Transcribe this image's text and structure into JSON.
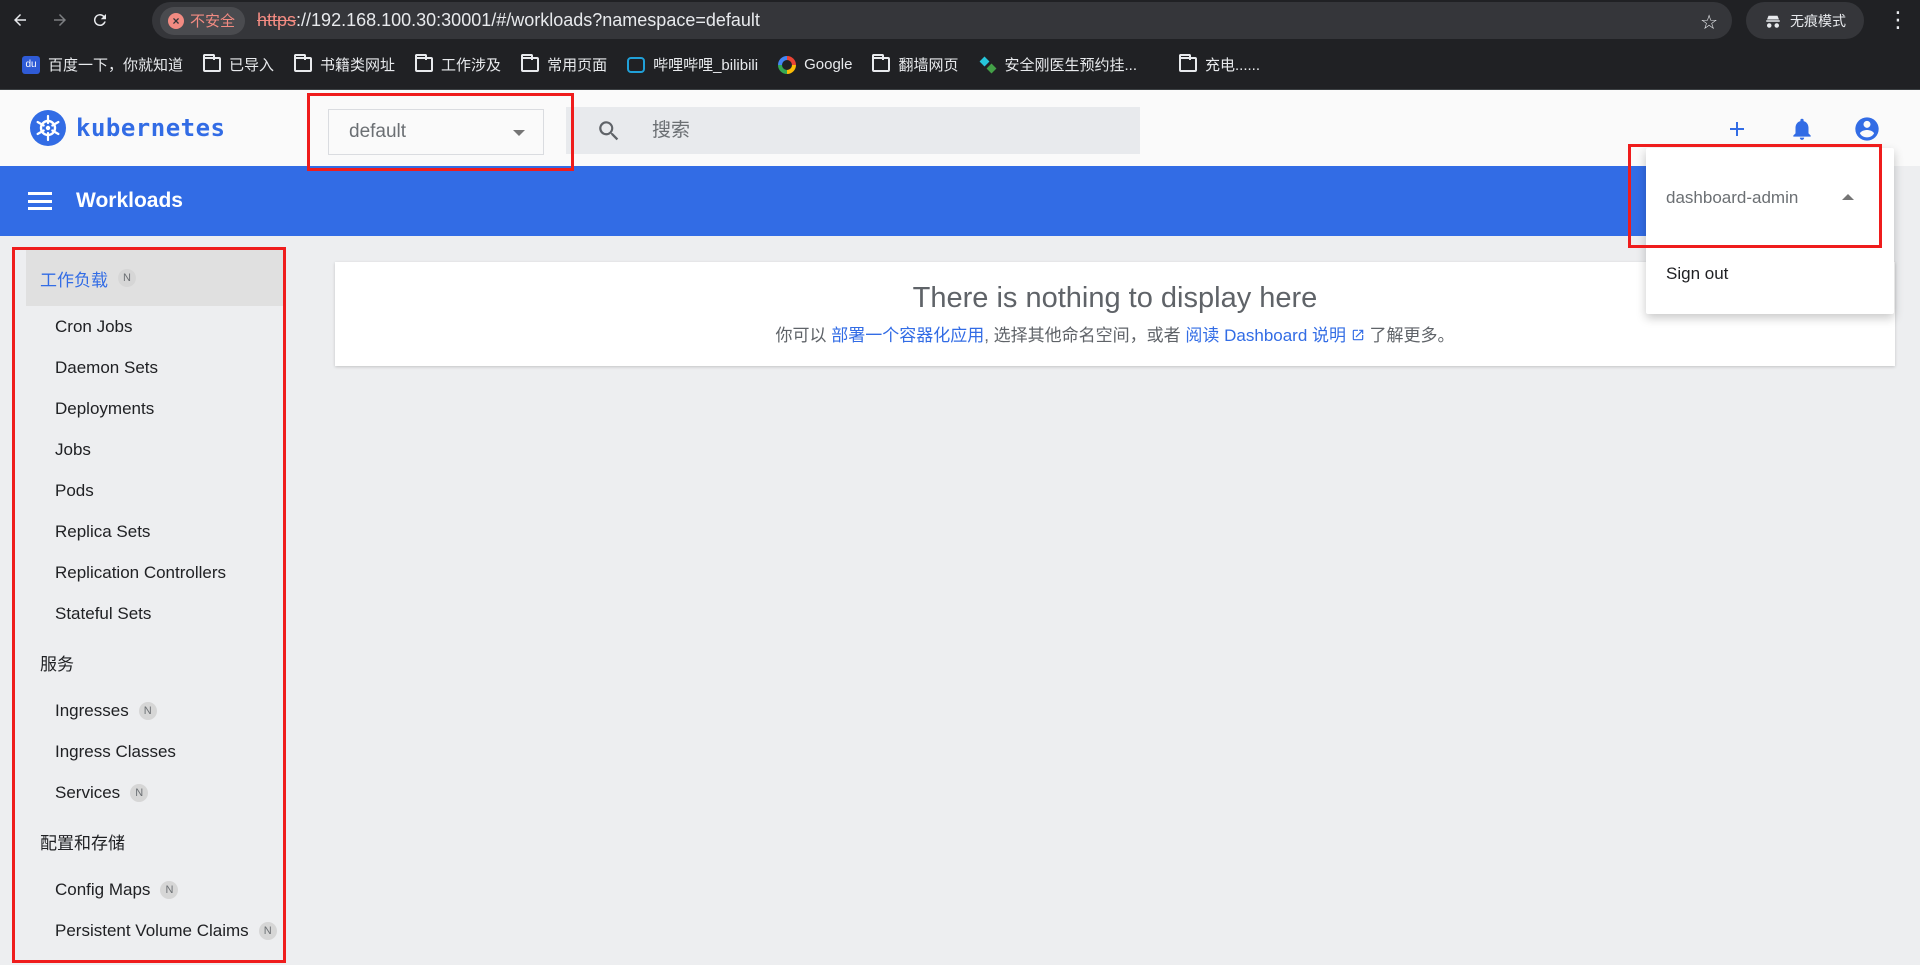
{
  "browser": {
    "insecure_label": "不安全",
    "url_scheme": "https",
    "url_rest": "://192.168.100.30:30001/#/workloads?namespace=default",
    "incognito_label": "无痕模式",
    "bookmarks": [
      {
        "label": "百度一下，你就知道",
        "icon": "baidu-icon"
      },
      {
        "label": "已导入",
        "icon": "folder-icon"
      },
      {
        "label": "书籍类网址",
        "icon": "folder-icon"
      },
      {
        "label": "工作涉及",
        "icon": "folder-icon"
      },
      {
        "label": "常用页面",
        "icon": "folder-icon"
      },
      {
        "label": "哔哩哔哩_bilibili",
        "icon": "bilibili-icon"
      },
      {
        "label": "Google",
        "icon": "google-icon"
      },
      {
        "label": "翻墙网页",
        "icon": "folder-icon"
      },
      {
        "label": "安全刚医生预约挂...",
        "icon": "site-icon"
      },
      {
        "label": "充电......",
        "icon": "folder-icon"
      }
    ]
  },
  "header": {
    "brand": "kubernetes",
    "namespace": "default",
    "search_placeholder": "搜索"
  },
  "title_bar": {
    "title": "Workloads"
  },
  "sidebar": {
    "sections": [
      {
        "label": "工作负载",
        "badge": "N",
        "items": [
          {
            "label": "Cron Jobs",
            "badge": ""
          },
          {
            "label": "Daemon Sets",
            "badge": ""
          },
          {
            "label": "Deployments",
            "badge": ""
          },
          {
            "label": "Jobs",
            "badge": ""
          },
          {
            "label": "Pods",
            "badge": ""
          },
          {
            "label": "Replica Sets",
            "badge": ""
          },
          {
            "label": "Replication Controllers",
            "badge": ""
          },
          {
            "label": "Stateful Sets",
            "badge": ""
          }
        ]
      },
      {
        "label": "服务",
        "badge": "",
        "items": [
          {
            "label": "Ingresses",
            "badge": "N"
          },
          {
            "label": "Ingress Classes",
            "badge": ""
          },
          {
            "label": "Services",
            "badge": "N"
          }
        ]
      },
      {
        "label": "配置和存储",
        "badge": "",
        "items": [
          {
            "label": "Config Maps",
            "badge": "N"
          },
          {
            "label": "Persistent Volume Claims",
            "badge": "N"
          }
        ]
      }
    ]
  },
  "empty_state": {
    "title": "There is nothing to display here",
    "desc_prefix": "你可以 ",
    "desc_link1": "部署一个容器化应用",
    "desc_mid": ", 选择其他命名空间，或者 ",
    "desc_link2": "阅读 Dashboard 说明",
    "desc_suffix": " 了解更多。"
  },
  "user_menu": {
    "username": "dashboard-admin",
    "sign_out": "Sign out"
  },
  "colors": {
    "brand_blue": "#326ce5",
    "highlight_red": "#ef1c1c"
  }
}
